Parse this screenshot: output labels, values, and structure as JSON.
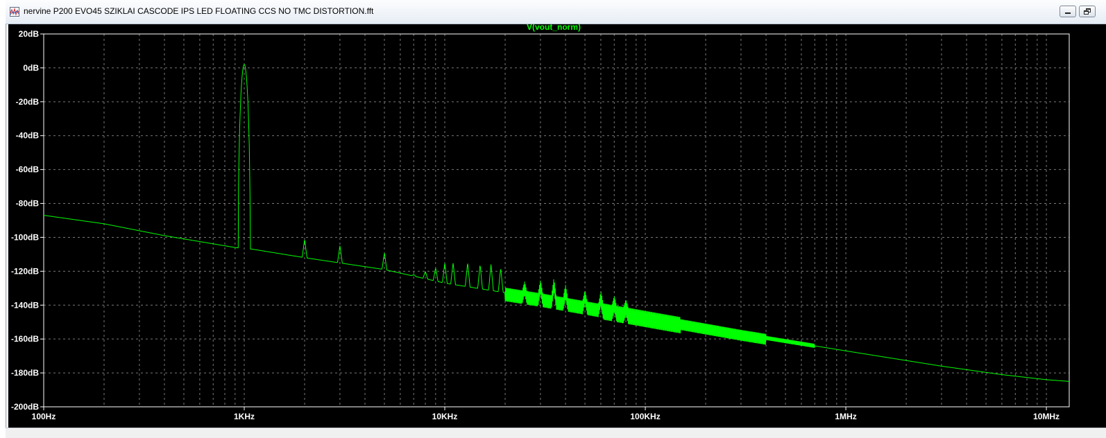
{
  "window": {
    "title": "nervine P200 EVO45 SZIKLAI CASCODE IPS LED FLOATING CCS NO TMC DISTORTION.fft",
    "icon": "waveform-document-icon",
    "controls": [
      "minimize",
      "restore"
    ]
  },
  "colors": {
    "background": "#000000",
    "trace": "#00ff00",
    "axis_text": "#ffffff",
    "grid": "#7a7a7a"
  },
  "chart_data": {
    "type": "line",
    "title": "V(vout_norm)",
    "xlabel": "",
    "ylabel": "",
    "xscale": "log",
    "xlim": [
      100,
      13000000
    ],
    "ylim": [
      -200,
      20
    ],
    "grid": true,
    "xticks": [
      {
        "value": 100,
        "label": "100Hz"
      },
      {
        "value": 1000,
        "label": "1KHz"
      },
      {
        "value": 10000,
        "label": "10KHz"
      },
      {
        "value": 100000,
        "label": "100KHz"
      },
      {
        "value": 1000000,
        "label": "1MHz"
      },
      {
        "value": 10000000,
        "label": "10MHz"
      }
    ],
    "yticks": [
      {
        "value": 20,
        "label": "20dB"
      },
      {
        "value": 0,
        "label": "0dB"
      },
      {
        "value": -20,
        "label": "-20dB"
      },
      {
        "value": -40,
        "label": "-40dB"
      },
      {
        "value": -60,
        "label": "-60dB"
      },
      {
        "value": -80,
        "label": "-80dB"
      },
      {
        "value": -100,
        "label": "-100dB"
      },
      {
        "value": -120,
        "label": "-120dB"
      },
      {
        "value": -140,
        "label": "-140dB"
      },
      {
        "value": -160,
        "label": "-160dB"
      },
      {
        "value": -180,
        "label": "-180dB"
      },
      {
        "value": -200,
        "label": "-200dB"
      }
    ],
    "series": [
      {
        "color": "#00ff00",
        "noise_floor": {
          "x": [
            100,
            200,
            400,
            900,
            1100,
            2000,
            5000,
            10000,
            30000,
            100000,
            300000,
            1000000,
            3000000,
            6000000,
            10000000,
            13000000
          ],
          "y": [
            -87,
            -92,
            -99,
            -106,
            -107,
            -112,
            -119,
            -127,
            -136,
            -147,
            -157,
            -167,
            -176,
            -181,
            -184,
            -185
          ]
        },
        "fundamental": {
          "x": 1000,
          "y": 2
        },
        "peaks": [
          {
            "x": 2000,
            "y": -101
          },
          {
            "x": 3000,
            "y": -105
          },
          {
            "x": 5000,
            "y": -109
          },
          {
            "x": 6000,
            "y": -124
          },
          {
            "x": 7000,
            "y": -122
          },
          {
            "x": 8000,
            "y": -120
          },
          {
            "x": 9000,
            "y": -118
          },
          {
            "x": 10000,
            "y": -115
          },
          {
            "x": 11000,
            "y": -115
          },
          {
            "x": 13000,
            "y": -115
          },
          {
            "x": 15000,
            "y": -116
          },
          {
            "x": 17000,
            "y": -116
          },
          {
            "x": 19000,
            "y": -118
          },
          {
            "x": 25000,
            "y": -129
          },
          {
            "x": 30000,
            "y": -128
          },
          {
            "x": 35000,
            "y": -127
          },
          {
            "x": 40000,
            "y": -131
          },
          {
            "x": 50000,
            "y": -134
          },
          {
            "x": 60000,
            "y": -135
          },
          {
            "x": 70000,
            "y": -138
          },
          {
            "x": 80000,
            "y": -140
          }
        ]
      }
    ]
  }
}
